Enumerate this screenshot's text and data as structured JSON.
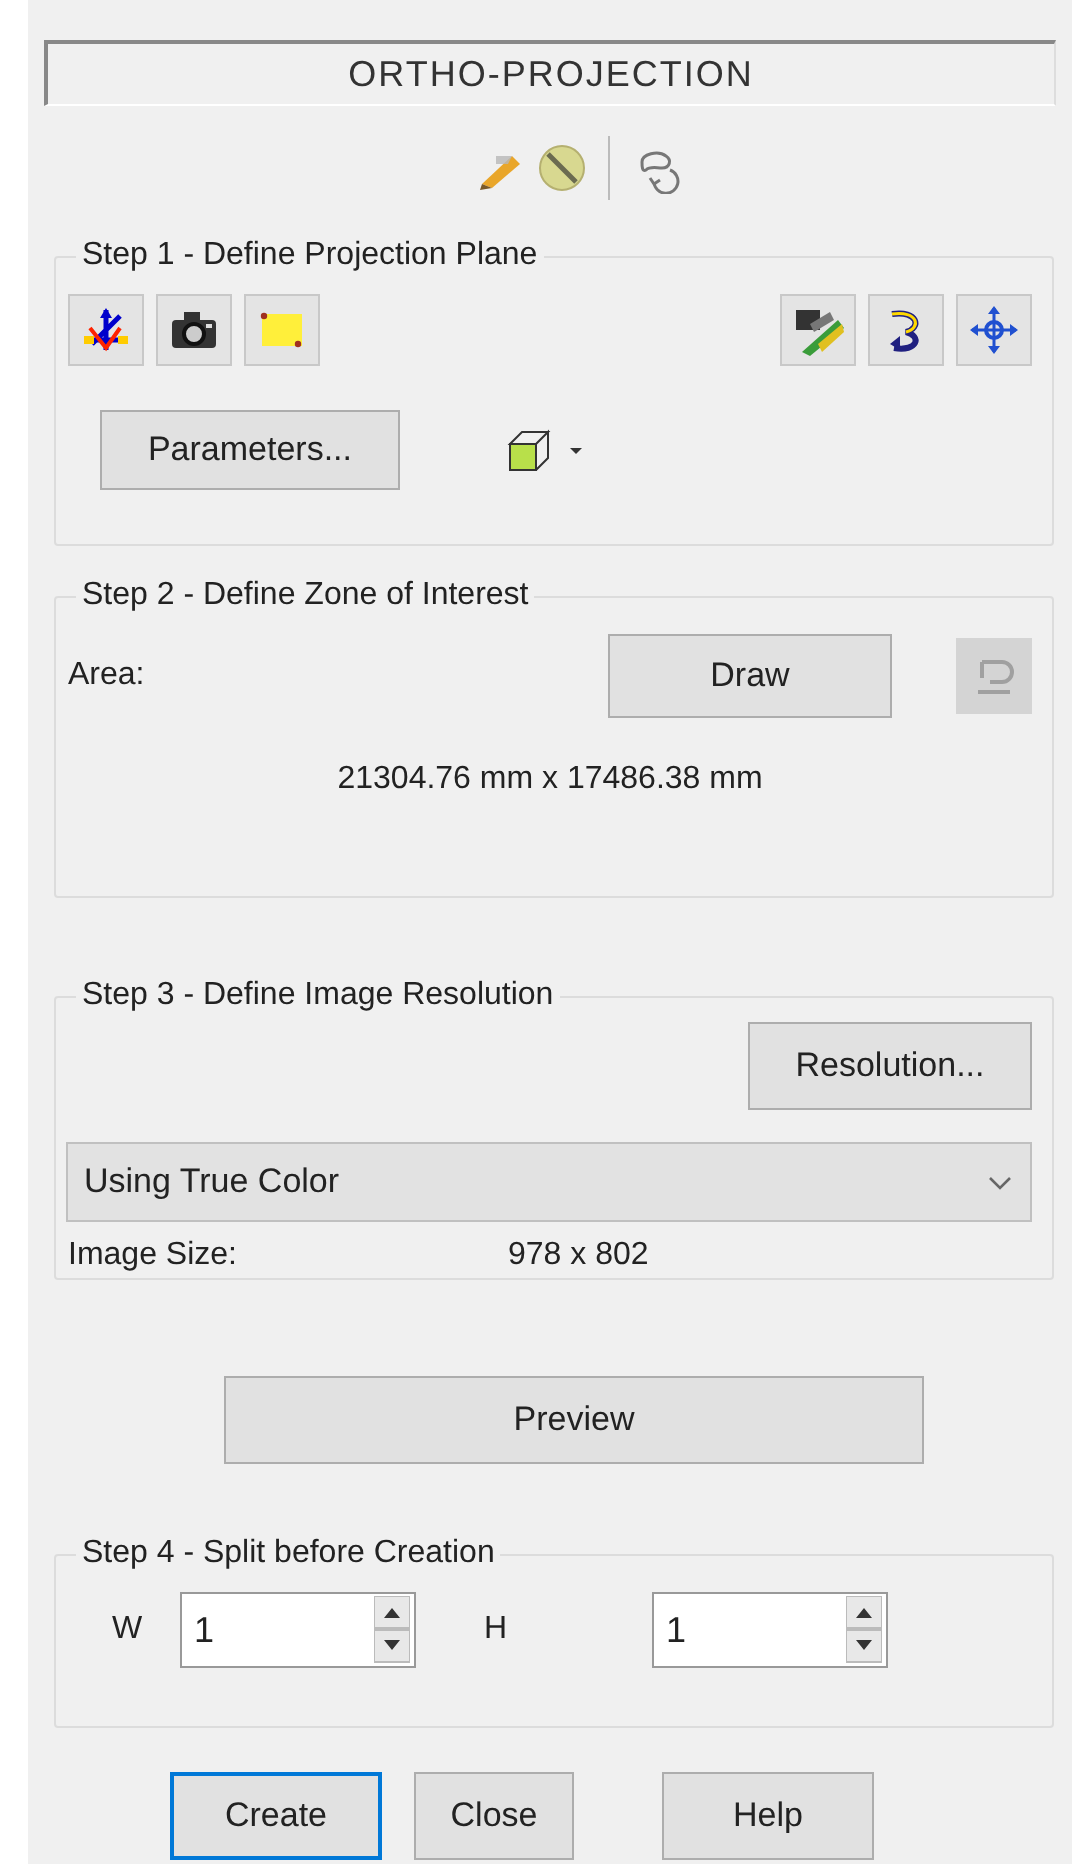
{
  "title": "ORTHO-PROJECTION",
  "sections": [
    {
      "kind": "plane",
      "label": "Step 1 - Define Projection Plane",
      "button": "Parameters..."
    },
    {
      "kind": "zone",
      "label": "Step 2 - Define Zone of Interest",
      "area_label": "Area:",
      "button": "Draw",
      "undo_disabled": true,
      "dimensions": "21304.76 mm x 17486.38 mm"
    },
    {
      "kind": "resolution",
      "label": "Step 3 - Define Image Resolution",
      "button": "Resolution...",
      "color_mode": "Using True Color",
      "size_label": "Image Size:",
      "size_value": "978 x 802"
    },
    {
      "kind": "preview",
      "button": "Preview"
    },
    {
      "kind": "split",
      "label": "Step 4 - Split before Creation",
      "fields": [
        {
          "label": "W",
          "value": "1"
        },
        {
          "label": "H",
          "value": "1"
        }
      ]
    }
  ],
  "buttons": [
    {
      "label": "Create",
      "default": true
    },
    {
      "label": "Close",
      "default": false
    },
    {
      "label": "Help",
      "default": false
    }
  ]
}
